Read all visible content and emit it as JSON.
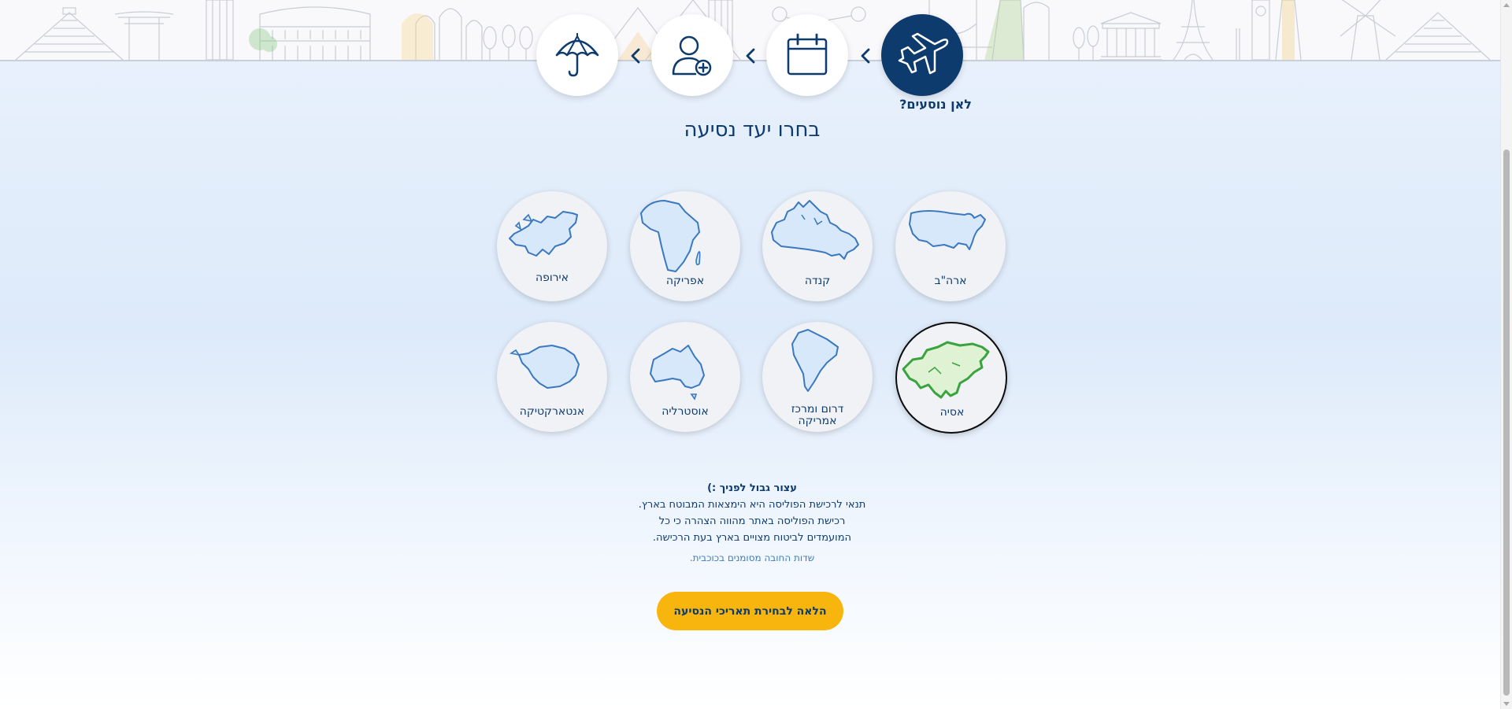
{
  "stepper": {
    "steps": [
      {
        "icon": "airplane-icon",
        "state": "active"
      },
      {
        "icon": "calendar-icon",
        "state": "inactive"
      },
      {
        "icon": "add-user-icon",
        "state": "inactive"
      },
      {
        "icon": "umbrella-icon",
        "state": "inactive"
      }
    ],
    "active_label": "לאן נוסעים?"
  },
  "title": "בחרו יעד נסיעה",
  "destinations": [
    {
      "label": "ארה\"ב",
      "map": "usa-map-icon",
      "selected": false
    },
    {
      "label": "קנדה",
      "map": "canada-map-icon",
      "selected": false
    },
    {
      "label": "אפריקה",
      "map": "africa-map-icon",
      "selected": false
    },
    {
      "label": "אירופה",
      "map": "europe-map-icon",
      "selected": false
    },
    {
      "label": "אסיה",
      "map": "asia-map-icon",
      "selected": true
    },
    {
      "label_line1": "דרום ומרכז",
      "label_line2": "אמריקה",
      "map": "south-america-map-icon",
      "selected": false
    },
    {
      "label": "אוסטרליה",
      "map": "australia-map-icon",
      "selected": false
    },
    {
      "label": "אנטארקטיקה",
      "map": "antarctica-map-icon",
      "selected": false
    }
  ],
  "info": {
    "title": "עצור גבול לפניך :)",
    "line1": "תנאי לרכישת הפוליסה היא הימצאות המבוטח בארץ.",
    "line2": "רכישת הפוליסה באתר מהווה הצהרה כי כל",
    "line3": "המועמדים לביטוח מצויים בארץ בעת הרכישה."
  },
  "required_note": "שדות החובה מסומנים בכוכבית.",
  "cta_label": "הלאה לבחירת תאריכי הנסיעה",
  "colors": {
    "primary": "#0e3b6e",
    "accent": "#f8b50d",
    "selected_map": "#3aa33f",
    "map_fill": "#d8e8fb",
    "map_stroke": "#3a78c0"
  }
}
